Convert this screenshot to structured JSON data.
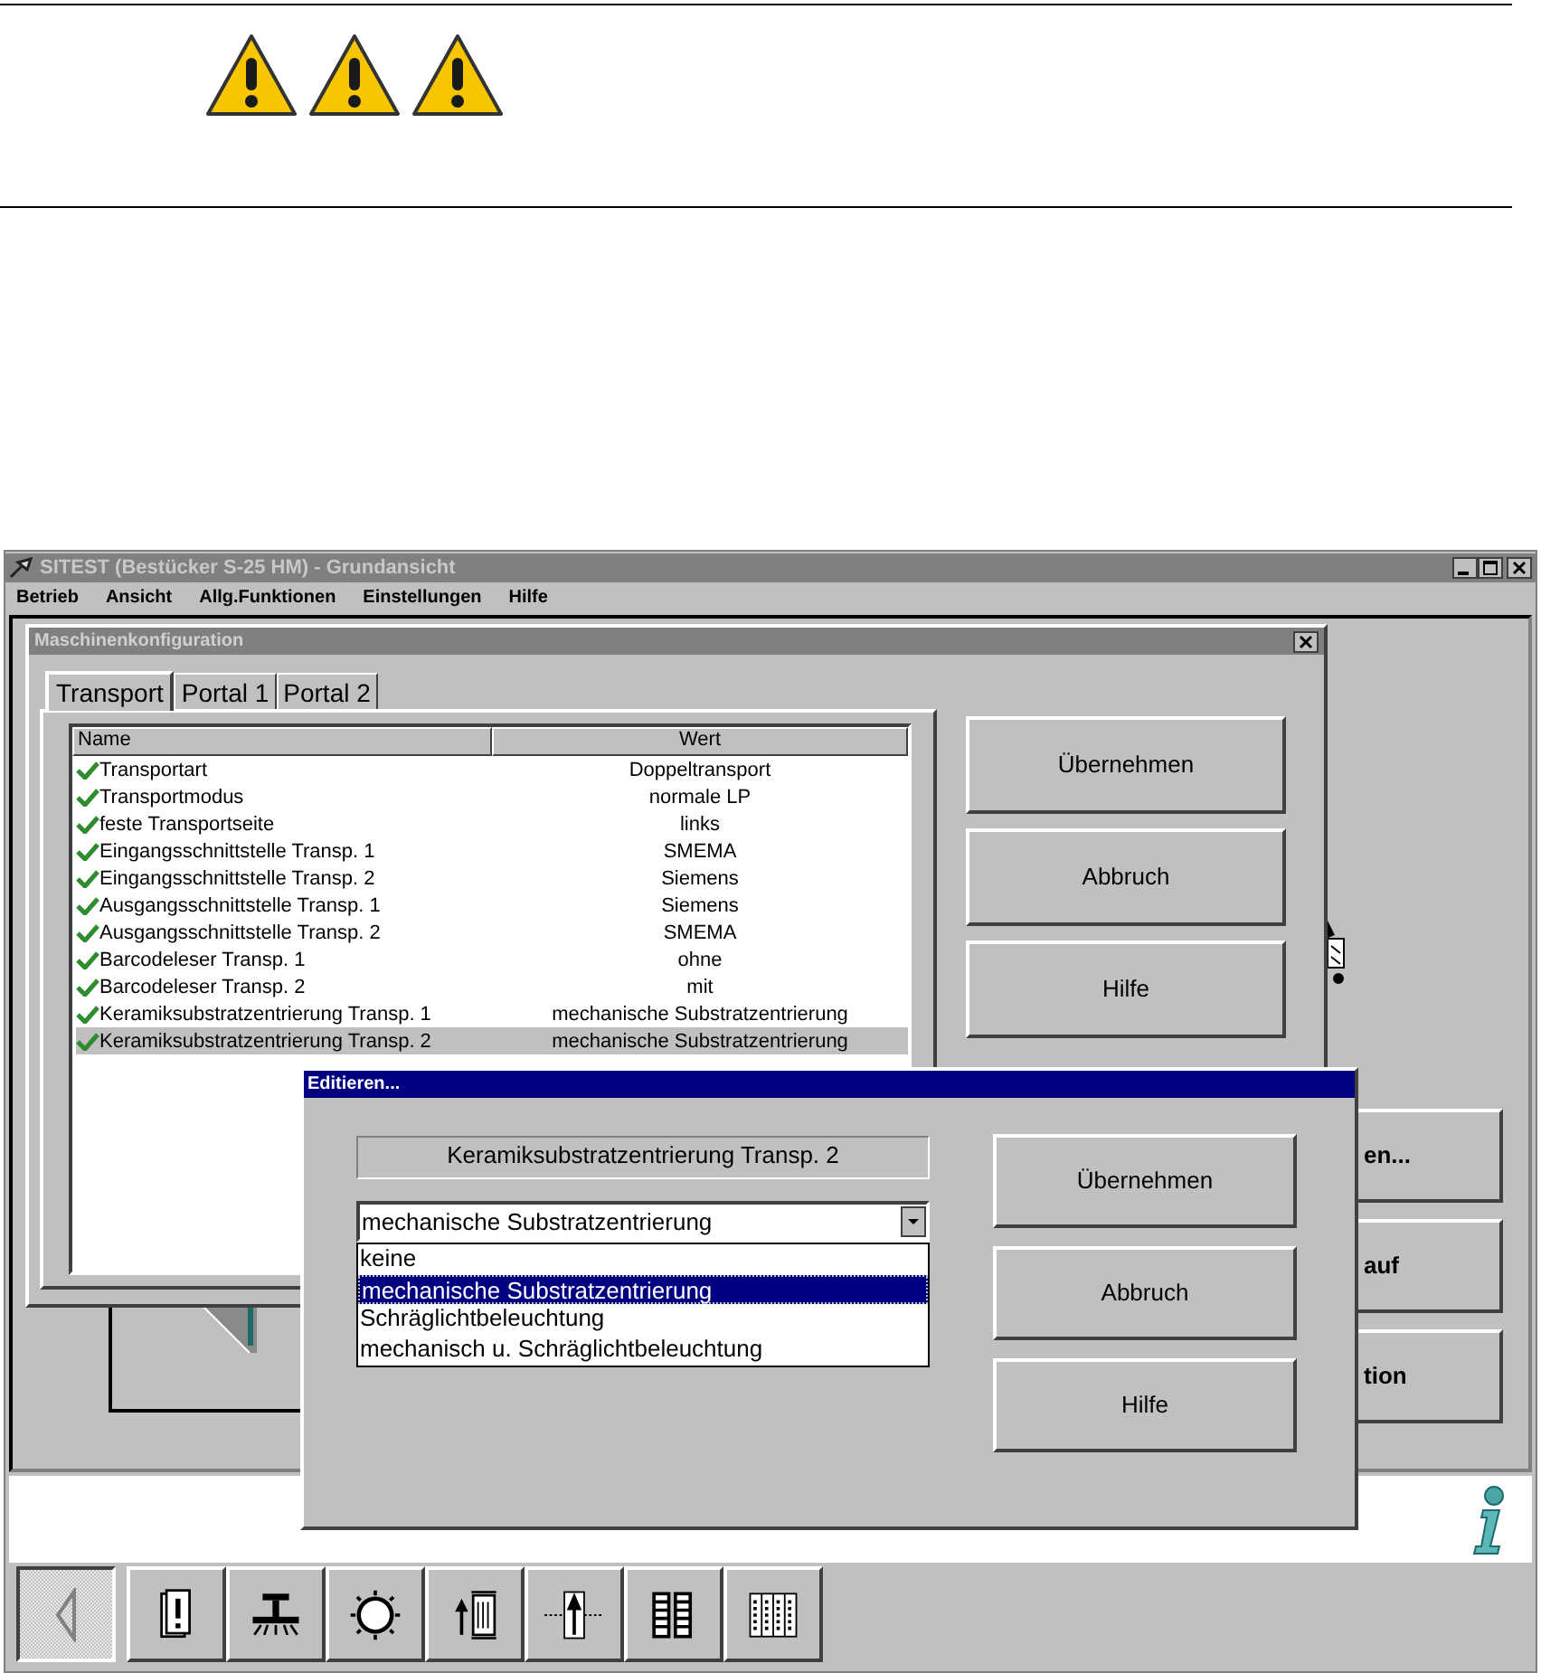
{
  "window": {
    "title": "SITEST (Bestücker S-25 HM) - Grundansicht"
  },
  "menu": [
    "Betrieb",
    "Ansicht",
    "Allg.Funktionen",
    "Einstellungen",
    "Hilfe"
  ],
  "config_dialog": {
    "title": "Maschinenkonfiguration",
    "tabs": [
      {
        "label": "Transport",
        "selected": true
      },
      {
        "label": "Portal 1",
        "selected": false
      },
      {
        "label": "Portal 2",
        "selected": false
      }
    ],
    "columns": [
      "Name",
      "Wert"
    ],
    "rows": [
      {
        "name": "Transportart",
        "value": "Doppeltransport",
        "selected": false
      },
      {
        "name": "Transportmodus",
        "value": "normale LP",
        "selected": false
      },
      {
        "name": "feste Transportseite",
        "value": "links",
        "selected": false
      },
      {
        "name": "Eingangsschnittstelle Transp. 1",
        "value": "SMEMA",
        "selected": false
      },
      {
        "name": "Eingangsschnittstelle Transp. 2",
        "value": "Siemens",
        "selected": false
      },
      {
        "name": "Ausgangsschnittstelle Transp. 1",
        "value": "Siemens",
        "selected": false
      },
      {
        "name": "Ausgangsschnittstelle Transp. 2",
        "value": "SMEMA",
        "selected": false
      },
      {
        "name": "Barcodeleser Transp. 1",
        "value": "ohne",
        "selected": false
      },
      {
        "name": "Barcodeleser Transp. 2",
        "value": "mit",
        "selected": false
      },
      {
        "name": "Keramiksubstratzentrierung Transp. 1",
        "value": "mechanische Substratzentrierung",
        "selected": false
      },
      {
        "name": "Keramiksubstratzentrierung Transp. 2",
        "value": "mechanische Substratzentrierung",
        "selected": true
      }
    ],
    "buttons": [
      "Übernehmen",
      "Abbruch",
      "Hilfe"
    ]
  },
  "background_buttons": [
    "en...",
    "auf",
    "tion"
  ],
  "edit_dialog": {
    "title": "Editieren...",
    "field_label": "Keramiksubstratzentrierung Transp. 2",
    "combo": {
      "value": "mechanische Substratzentrierung",
      "options": [
        {
          "label": "keine",
          "selected": false
        },
        {
          "label": "mechanische Substratzentrierung",
          "selected": true
        },
        {
          "label": "Schräglichtbeleuchtung",
          "selected": false
        },
        {
          "label": "mechanisch u. Schräglichtbeleuchtung",
          "selected": false
        }
      ]
    },
    "buttons": [
      "Übernehmen",
      "Abbruch",
      "Hilfe"
    ]
  },
  "toolbar": [
    {
      "kind": "back",
      "pressed": true
    },
    {
      "kind": "alert",
      "pressed": false
    },
    {
      "kind": "nozzle",
      "pressed": false
    },
    {
      "kind": "sun",
      "pressed": false
    },
    {
      "kind": "board",
      "pressed": false
    },
    {
      "kind": "arrow",
      "pressed": false
    },
    {
      "kind": "grid",
      "pressed": false
    },
    {
      "kind": "feeder",
      "pressed": false
    }
  ]
}
